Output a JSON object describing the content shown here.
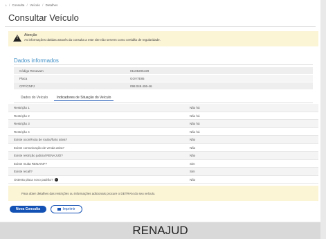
{
  "breadcrumb": [
    "Consulta",
    "Veículo",
    "Detalhes"
  ],
  "page_title": "Consultar Veículo",
  "alert": {
    "title": "Atenção",
    "text": "As informações obtidas através da consulta a este site não servem como certidão de regularidade."
  },
  "section_title": "Dados informados",
  "info_rows": [
    {
      "label": "Código Renavam",
      "value": "01105205429"
    },
    {
      "label": "Placa",
      "value": "GOV7E85"
    },
    {
      "label": "CPF/CNPJ",
      "value": "098.049.406-46"
    }
  ],
  "tabs": [
    {
      "label": "Dados do Veículo"
    },
    {
      "label": "Indicadores de Situação do Veículo"
    }
  ],
  "indicators": [
    {
      "label": "Restrição 1",
      "value": "Não há"
    },
    {
      "label": "Restrição 2",
      "value": "Não há"
    },
    {
      "label": "Restrição 3",
      "value": "Não há"
    },
    {
      "label": "Restrição 4",
      "value": "Não há"
    },
    {
      "label": "Existe ocorrência de roubo/furto ativa?",
      "value": "Não"
    },
    {
      "label": "Existe comunicação de venda ativa?",
      "value": "Não"
    },
    {
      "label": "Existe restrição judicial RENAJUD?",
      "value": "Não"
    },
    {
      "label": "Existe multa RENAINF?",
      "value": "Sim"
    },
    {
      "label": "Existe recall?",
      "value": "Sim"
    },
    {
      "label": "Ostenta placa novo padrão?",
      "value": "Não"
    }
  ],
  "footer_note": "Para obter detalhes das restrições ou informações adicionais procure o DETRAN do seu veículo.",
  "buttons": {
    "new_query": "Nova Consulta",
    "print": "Imprimir"
  },
  "caption": "RENAJUD",
  "colors": {
    "primary": "#1351b4",
    "section_title": "#3f8fc6",
    "alert_bg": "#fbf4d5"
  }
}
